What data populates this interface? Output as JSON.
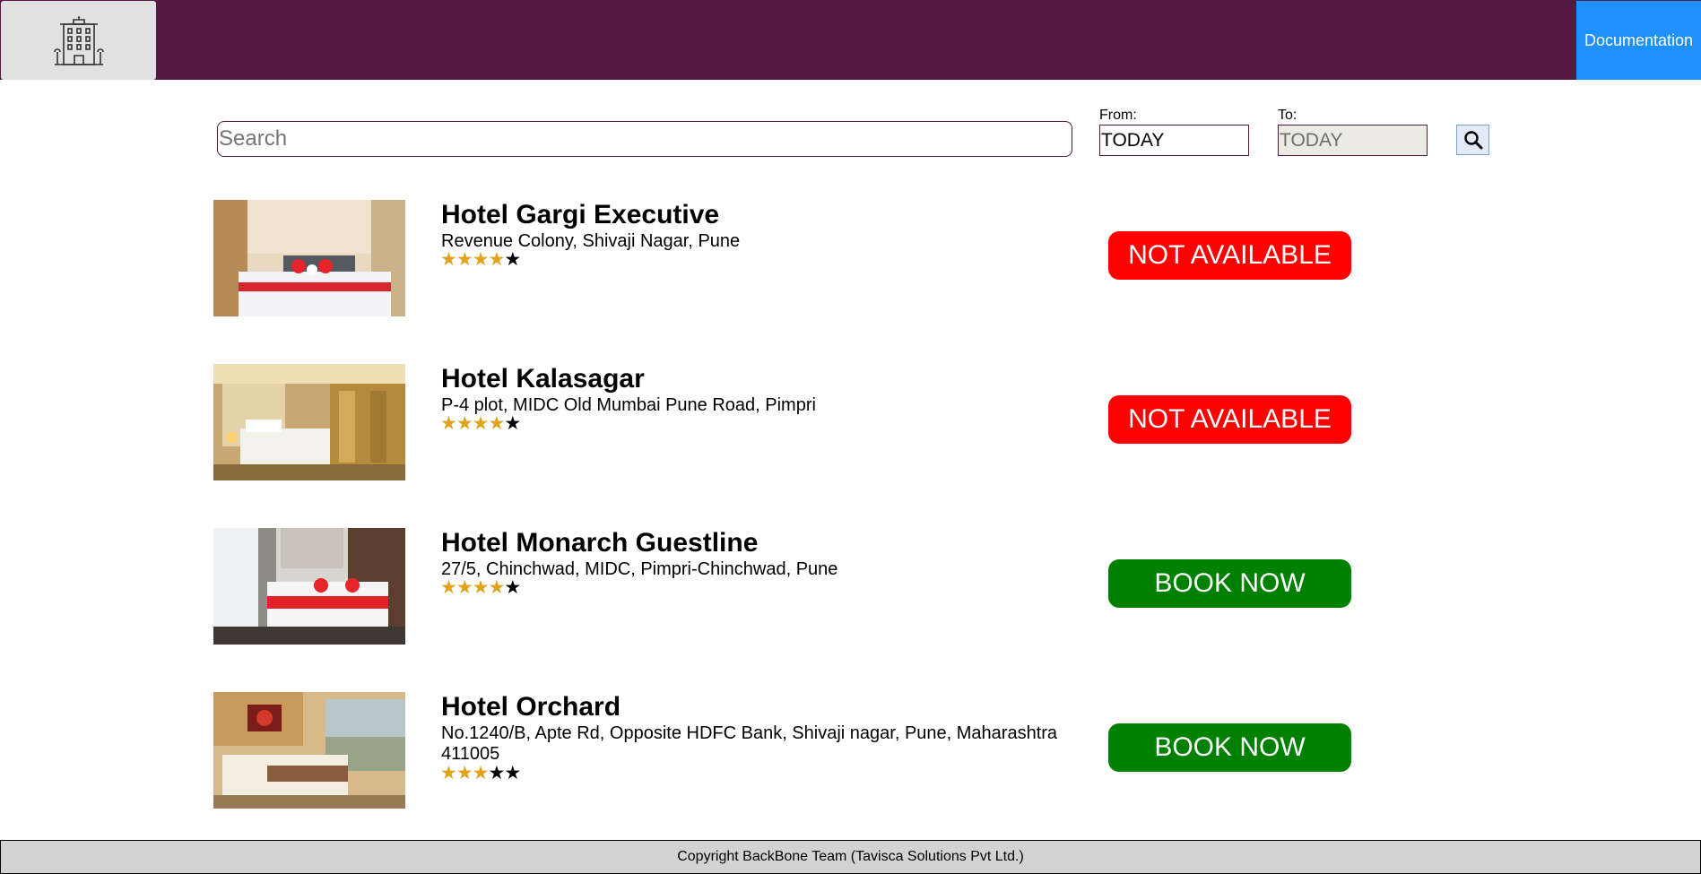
{
  "header": {
    "logo": "hotel-building-icon",
    "documentation_label": "Documentation",
    "background": "#561845"
  },
  "search": {
    "placeholder": "Search",
    "value": "",
    "from_label": "From:",
    "from_value": "TODAY",
    "to_label": "To:",
    "to_value": "TODAY",
    "button_icon": "magnifier-icon"
  },
  "hotels": [
    {
      "name": "Hotel Gargi Executive",
      "address": "Revenue Colony, Shivaji Nagar, Pune",
      "rating": 4,
      "max_rating": 5,
      "status": "NOT AVAILABLE"
    },
    {
      "name": "Hotel Kalasagar",
      "address": "P-4 plot, MIDC Old Mumbai Pune Road, Pimpri",
      "rating": 4,
      "max_rating": 5,
      "status": "NOT AVAILABLE"
    },
    {
      "name": "Hotel Monarch Guestline",
      "address": "27/5, Chinchwad, MIDC, Pimpri-Chinchwad, Pune",
      "rating": 4,
      "max_rating": 5,
      "status": "BOOK NOW"
    },
    {
      "name": "Hotel Orchard",
      "address": "No.1240/B, Apte Rd, Opposite HDFC Bank, Shivaji nagar, Pune, Maharashtra 411005",
      "rating": 3,
      "max_rating": 5,
      "status": "BOOK NOW"
    }
  ],
  "colors": {
    "not_available": "#ff0000",
    "book_now": "#008000",
    "star_filled": "#e0a31e",
    "star_empty": "#000000",
    "documentation_button": "#1e90ff"
  },
  "footer": {
    "copyright": "Copyright BackBone Team (Tavisca Solutions Pvt Ltd.)"
  }
}
